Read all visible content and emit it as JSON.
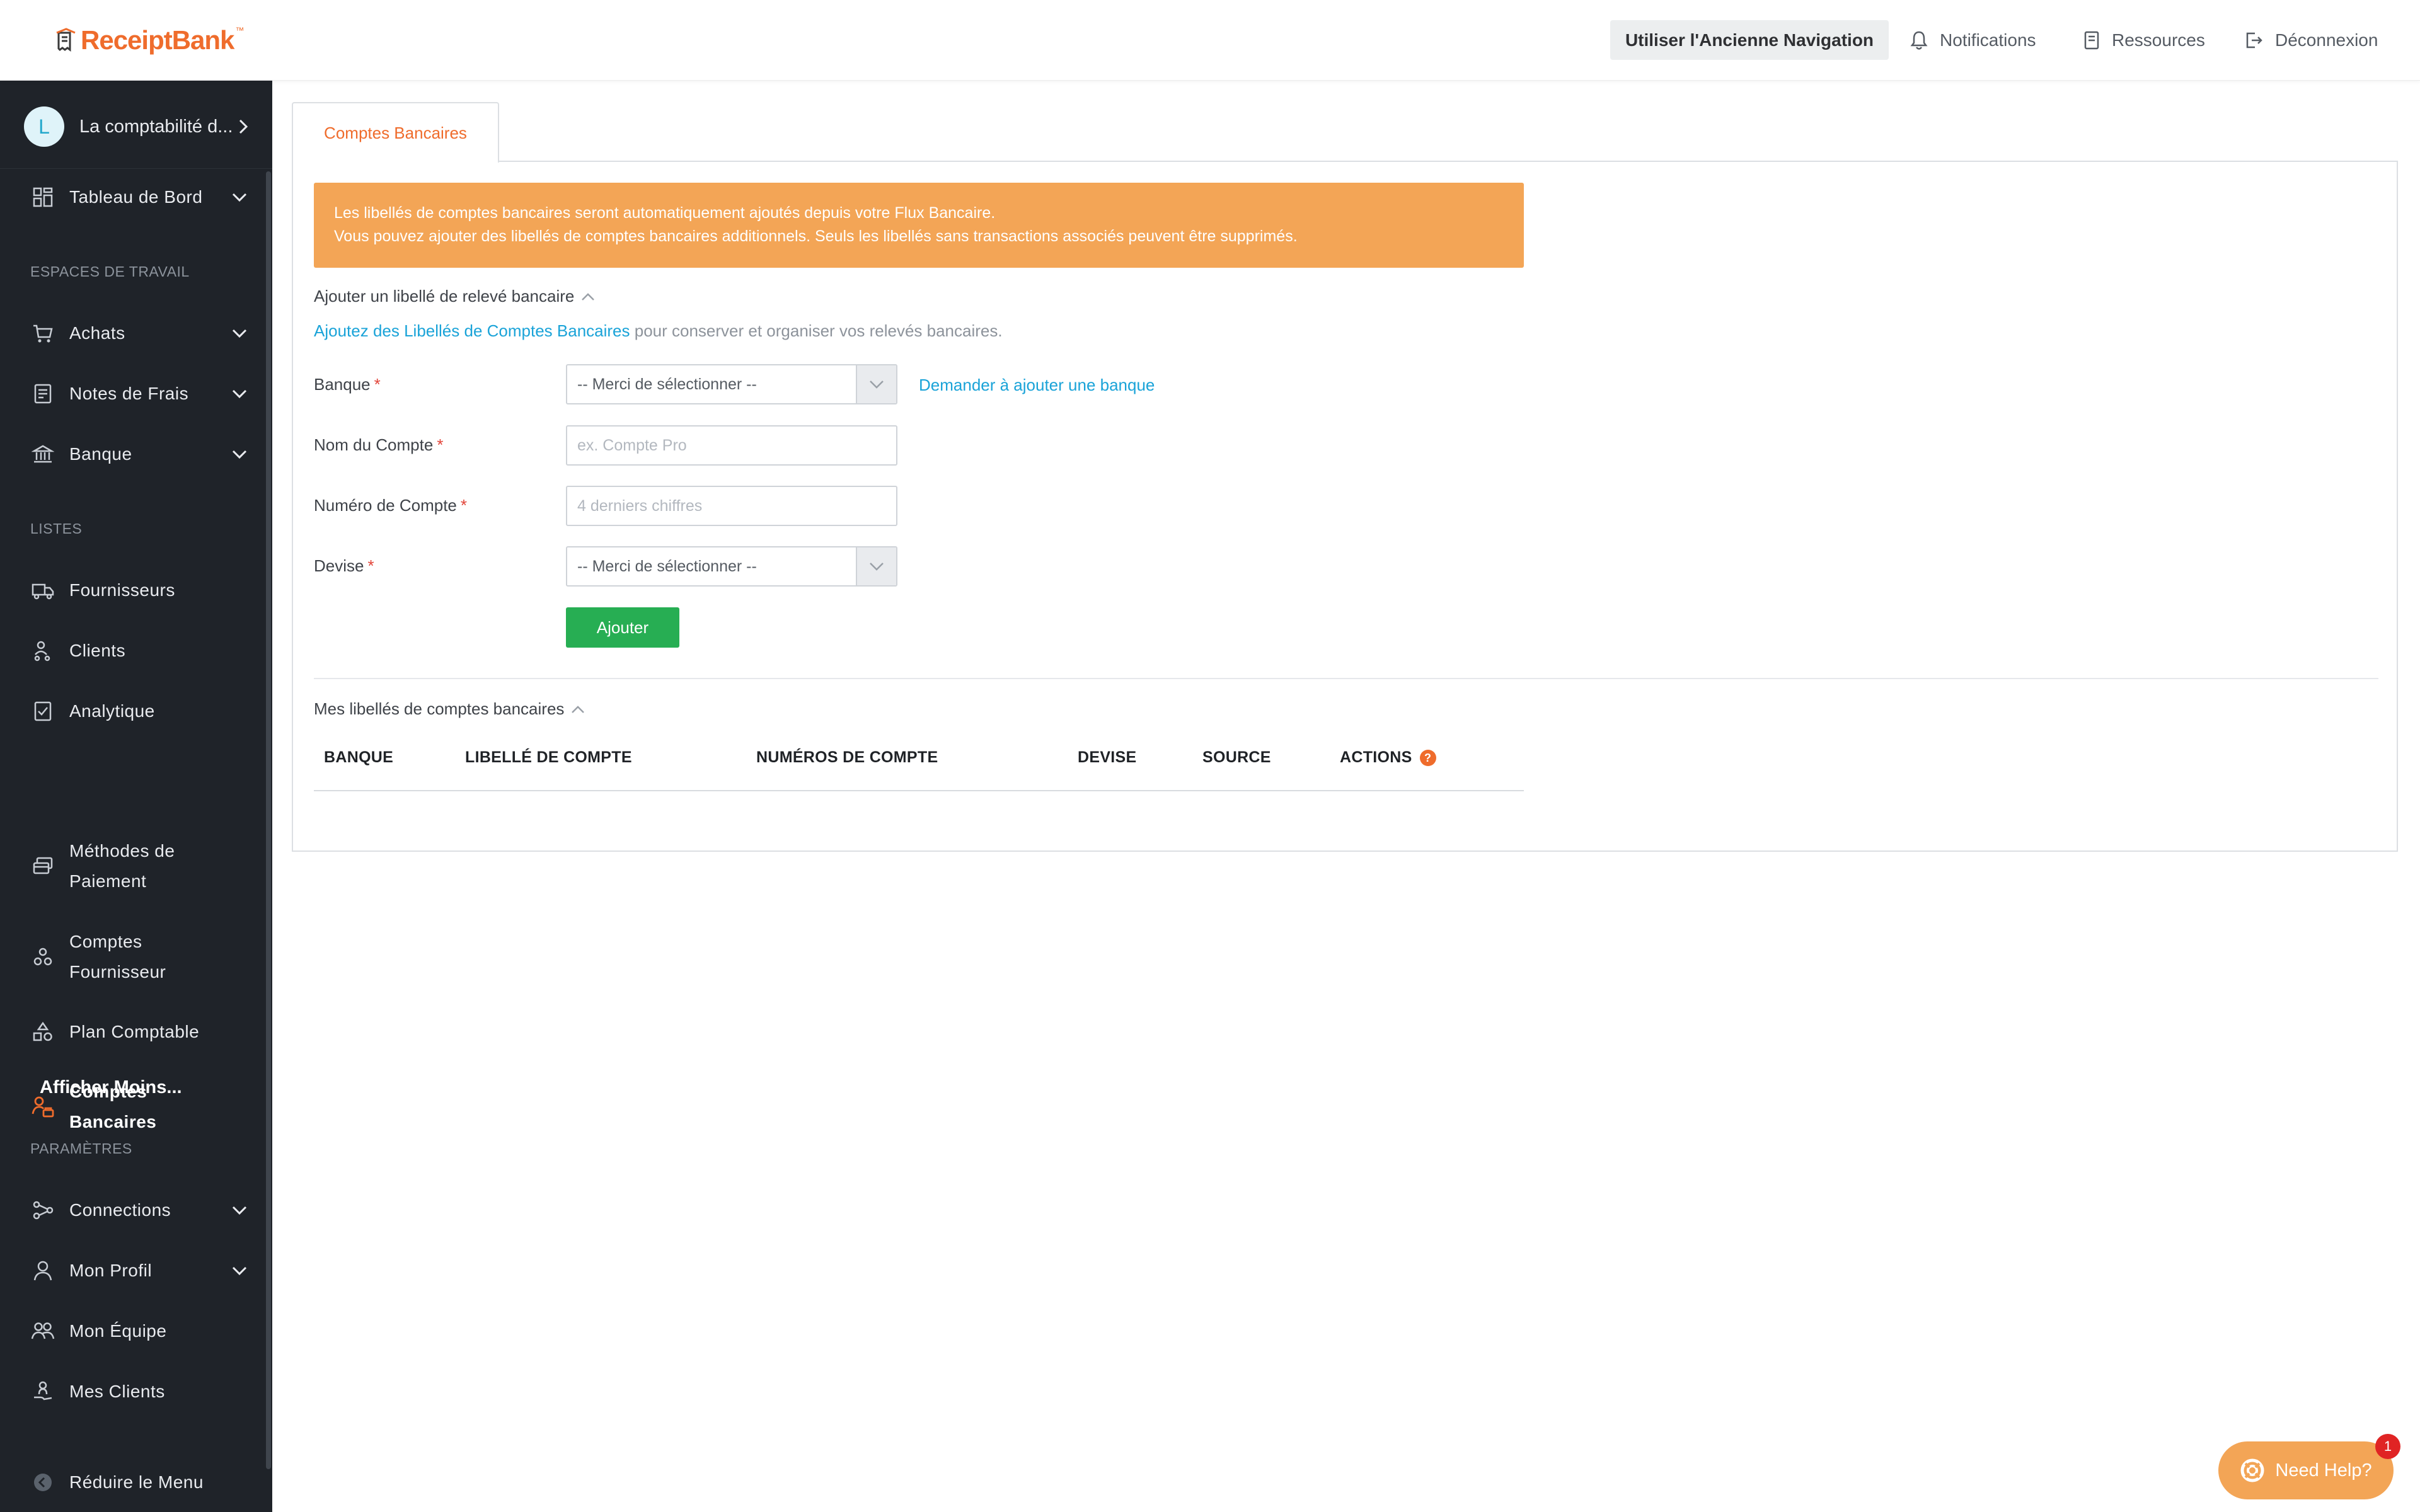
{
  "brand": {
    "logo_text": "ReceiptBank",
    "accent": "#ef6c2c"
  },
  "header": {
    "old_nav_label": "Utiliser l'Ancienne Navigation",
    "notifications_label": "Notifications",
    "resources_label": "Ressources",
    "logout_label": "Déconnexion"
  },
  "sidebar": {
    "account": {
      "initial": "L",
      "name": "La comptabilité d..."
    },
    "dashboard_label": "Tableau de Bord",
    "section_workspaces": "ESPACES DE TRAVAIL",
    "purchases_label": "Achats",
    "expenses_label": "Notes de Frais",
    "bank_label": "Banque",
    "section_lists": "LISTES",
    "suppliers_label": "Fournisseurs",
    "clients_label": "Clients",
    "analytics_label": "Analytique",
    "payment_methods_line1": "Méthodes de",
    "payment_methods_line2": "Paiement",
    "supplier_accounts_line1": "Comptes",
    "supplier_accounts_line2": "Fournisseur",
    "chart_of_accounts_label": "Plan Comptable",
    "bank_accounts_line1": "Comptes",
    "bank_accounts_line2": "Bancaires",
    "show_less_label": "Afficher Moins...",
    "section_settings": "PARAMÈTRES",
    "connections_label": "Connections",
    "profile_label": "Mon Profil",
    "team_label": "Mon Équipe",
    "my_clients_label": "Mes Clients",
    "collapse_label": "Réduire le Menu"
  },
  "main": {
    "tab_label": "Comptes Bancaires",
    "alert_line1": "Les libellés de comptes bancaires seront automatiquement ajoutés depuis votre Flux Bancaire.",
    "alert_line2": "Vous pouvez ajouter des libellés de comptes bancaires additionnels. Seuls les libellés sans transactions associés peuvent être supprimés.",
    "add_section_title": "Ajouter un libellé de relevé bancaire",
    "help_link": "Ajoutez des Libellés de Comptes Bancaires",
    "help_rest": " pour conserver et organiser vos relevés bancaires.",
    "form": {
      "bank_label": "Banque",
      "bank_value": "-- Merci de sélectionner --",
      "ask_bank_link": "Demander à ajouter une banque",
      "account_name_label": "Nom du Compte",
      "account_name_placeholder": "ex. Compte Pro",
      "account_number_label": "Numéro de Compte",
      "account_number_placeholder": "4 derniers chiffres",
      "currency_label": "Devise",
      "currency_value": "-- Merci de sélectionner --",
      "required_mark": "*",
      "submit_label": "Ajouter"
    },
    "list_section_title": "Mes libellés de comptes bancaires",
    "table_headers": {
      "bank": "BANQUE",
      "account_label": "LIBELLÉ DE COMPTE",
      "account_numbers": "NUMÉROS DE COMPTE",
      "currency": "DEVISE",
      "source": "SOURCE",
      "actions": "ACTIONS",
      "actions_help": "?"
    }
  },
  "need_help": {
    "label": "Need Help?",
    "badge": "1"
  }
}
